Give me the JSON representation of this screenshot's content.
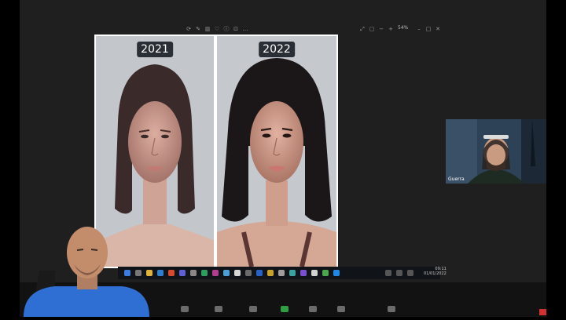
{
  "viewer": {
    "zoom_label": "54%",
    "tool_icons": [
      "rotate-icon",
      "edit-icon",
      "delete-icon",
      "heart-icon",
      "info-icon",
      "crop-icon",
      "more-icon"
    ],
    "window_icons": [
      "expand-icon",
      "fit-icon",
      "zoom-out-icon",
      "zoom-in-icon",
      "minimize-icon",
      "maximize-icon",
      "close-icon"
    ]
  },
  "image": {
    "left_label": "2021",
    "right_label": "2022"
  },
  "taskbar": {
    "time": "09:11",
    "date": "01/01/2022"
  },
  "webcam": {
    "name": "Guerra"
  },
  "colors": {
    "background": "#1f1f1f",
    "label_bg": "#2a2f35",
    "zoom_green": "#2ea043",
    "record_red": "#d03030"
  }
}
